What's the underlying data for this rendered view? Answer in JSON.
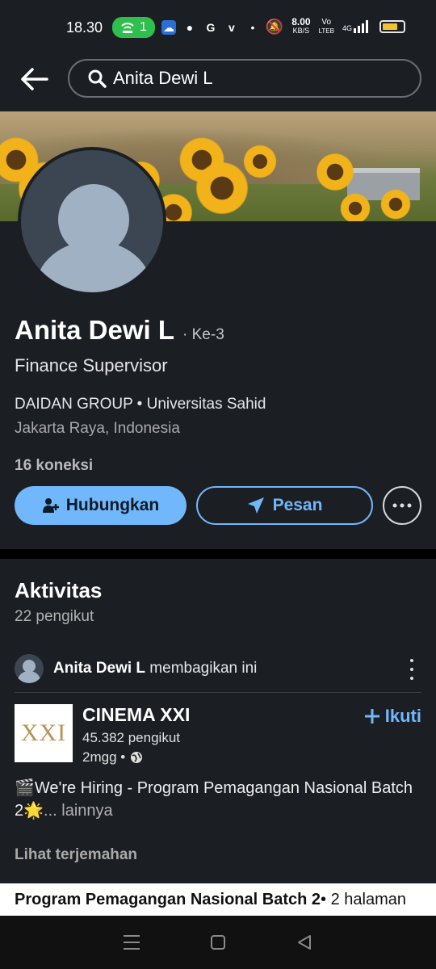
{
  "status_bar": {
    "time": "18.30",
    "hotspot_count": "1",
    "net_speed_value": "8.00",
    "net_speed_unit": "KB/S",
    "volte_top": "Vo",
    "volte_bottom": "LTEB",
    "network_type": "4G",
    "battery_level": 0.75
  },
  "search": {
    "query": "Anita Dewi L"
  },
  "profile": {
    "name": "Anita Dewi L",
    "degree": "· Ke-3",
    "headline": "Finance Supervisor",
    "education": "DAIDAN GROUP • Universitas Sahid",
    "location": "Jakarta Raya, Indonesia",
    "connections": "16 koneksi"
  },
  "actions": {
    "connect_label": "Hubungkan",
    "message_label": "Pesan"
  },
  "activity": {
    "title": "Aktivitas",
    "followers": "22 pengikut",
    "shared_by": "Anita Dewi L",
    "shared_suffix": " membagikan ini"
  },
  "post": {
    "logo_text": "XXI",
    "company": "CINEMA XXI",
    "company_followers": "45.382 pengikut",
    "age": "2mgg •",
    "follow_label": "Ikuti",
    "text": "🎬We're Hiring - Program Pemagangan Nasional Batch 2🌟",
    "more_label": "... lainnya",
    "translate_label": "Lihat terjemahan",
    "doc_title": "Program Pemagangan Nasional Batch 2",
    "doc_pages": " • 2 halaman"
  },
  "colors": {
    "background": "#1b1f23",
    "accent": "#71b7fb",
    "hotspot": "#2fbf4c"
  },
  "icons": [
    "back-arrow-icon",
    "search-icon",
    "add-person-icon",
    "send-icon",
    "more-icon",
    "kebab-icon",
    "globe-icon",
    "plus-icon",
    "menu-icon",
    "home-icon",
    "back-nav-icon"
  ]
}
